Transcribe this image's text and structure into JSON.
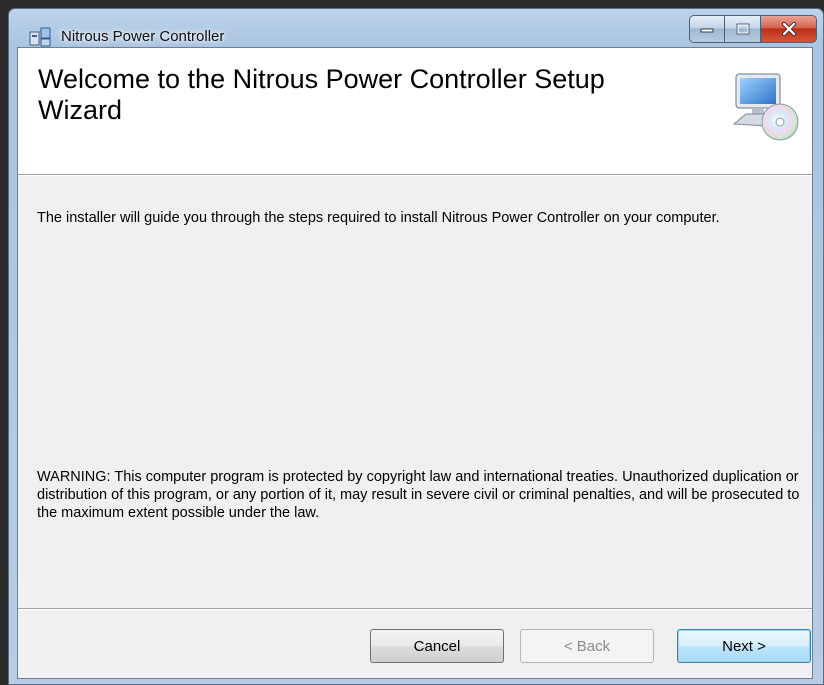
{
  "window": {
    "title": "Nitrous Power Controller"
  },
  "header": {
    "title": "Welcome to the Nitrous Power Controller Setup Wizard"
  },
  "body": {
    "intro": "The installer will guide you through the steps required to install Nitrous Power Controller on your computer.",
    "warning": "WARNING: This computer program is protected by copyright law and international treaties. Unauthorized duplication or distribution of this program, or any portion of it, may result in severe civil or criminal penalties, and will be prosecuted to the maximum extent possible under the law."
  },
  "buttons": {
    "cancel": "Cancel",
    "back": "< Back",
    "next": "Next >"
  },
  "icons": {
    "app": "installer-icon",
    "setup": "computer-cd-icon",
    "minimize": "minimize-icon",
    "maximize": "maximize-icon",
    "close": "close-icon"
  },
  "colors": {
    "client_bg": "#f0f0f0",
    "header_bg": "#ffffff",
    "close_red": "#c7432a",
    "next_border": "#3c7fb1"
  }
}
